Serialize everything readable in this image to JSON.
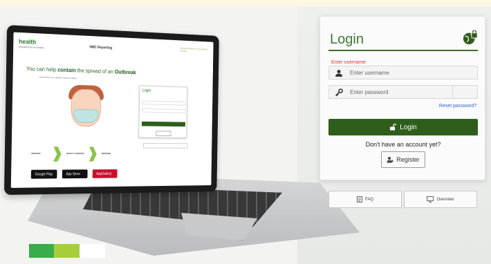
{
  "laptop_screen": {
    "logo": "health",
    "logo_sub": "Department of Health",
    "page_title": "NMC Reporting",
    "partner_text": "National Institute for Communicable Diseases",
    "headline_prefix": "You can help",
    "headline_bold": "contain",
    "headline_mid": "the spread of an",
    "headline_bold2": "Outbreak",
    "subline": "Notify NICD of a notifiable medical condition",
    "steps": [
      "PREVENT",
      "DETECT & REPORT",
      "RESPOND"
    ],
    "stores": [
      "Google Play",
      "App Store",
      "AppGallery"
    ],
    "mini_login_title": "Login"
  },
  "login": {
    "title": "Login",
    "username_label": "Enter username",
    "username_placeholder": "Enter username",
    "password_placeholder": "Enter password",
    "reset_link": "Reset password?",
    "login_button": "Login",
    "no_account_text": "Don't have an account yet?",
    "register_button": "Register"
  },
  "footer_buttons": {
    "faq": "FAQ",
    "overview": "Overview"
  },
  "colors": {
    "brand_green": "#2f5e1c",
    "title_green": "#3b7a2f",
    "error_red": "#d9342b",
    "link_blue": "#2e63c9",
    "stripe_green": "#3aac4a",
    "stripe_lime": "#a6ce39"
  },
  "icons": {
    "globe_lock": "globe-lock-icon",
    "user": "user-icon",
    "key": "key-icon",
    "unlock": "unlock-icon",
    "register": "user-plus-icon",
    "faq": "document-icon",
    "overview": "monitor-icon"
  }
}
